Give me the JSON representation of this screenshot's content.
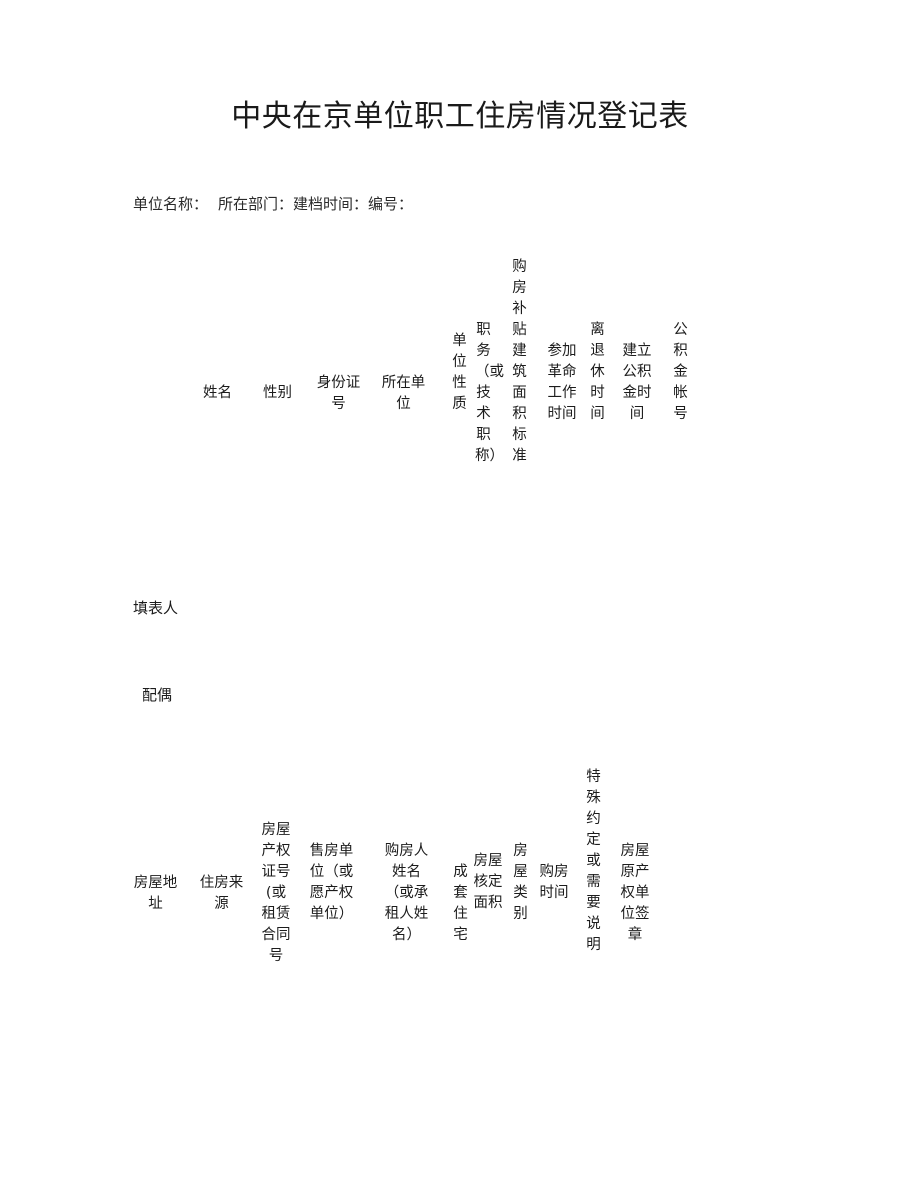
{
  "document": {
    "title": "中央在京单位职工住房情况登记表",
    "sub_header": {
      "unit_name_label": "单位名称：",
      "department_label": "所在部门：",
      "filing_date_label": "建档时间：",
      "serial_label": "编号："
    }
  },
  "table_personal": {
    "columns": [
      {
        "key": "name",
        "label": "姓名"
      },
      {
        "key": "gender",
        "label": "性别"
      },
      {
        "key": "id_number",
        "label": "身份证号"
      },
      {
        "key": "work_unit",
        "label": "所在单位"
      },
      {
        "key": "unit_nature",
        "label": "单位性质"
      },
      {
        "key": "position_title",
        "label": "职务（或技术职称）"
      },
      {
        "key": "subsidy_area_std",
        "label": "购房补贴建筑面积标准"
      },
      {
        "key": "revolution_date",
        "label": "参加革命工作时间"
      },
      {
        "key": "retirement_date",
        "label": "离退休时间"
      },
      {
        "key": "fund_start_date",
        "label": "建立公积金时间"
      },
      {
        "key": "fund_account",
        "label": "公积金帐号"
      }
    ],
    "rows": [
      {
        "key": "filler",
        "label": "填表人"
      },
      {
        "key": "spouse",
        "label": "配偶"
      }
    ]
  },
  "table_housing": {
    "columns": [
      {
        "key": "house_address",
        "label": "房屋地址"
      },
      {
        "key": "housing_source",
        "label": "住房来源"
      },
      {
        "key": "ownership_cert_no",
        "label": "房屋产权证号(或租赁合同号"
      },
      {
        "key": "selling_unit",
        "label": "售房单位（或愿产权单位）"
      },
      {
        "key": "buyer_name",
        "label": "购房人姓名（或承租人姓名）"
      },
      {
        "key": "complete_apartment",
        "label": "成套住宅"
      },
      {
        "key": "verified_area",
        "label": "房屋核定面积"
      },
      {
        "key": "house_category",
        "label": "房屋类别"
      },
      {
        "key": "purchase_date",
        "label": "购房时间"
      },
      {
        "key": "special_notes",
        "label": "特殊约定或需要说明"
      },
      {
        "key": "original_owner_seal",
        "label": "房屋原产权单位签章"
      }
    ]
  }
}
